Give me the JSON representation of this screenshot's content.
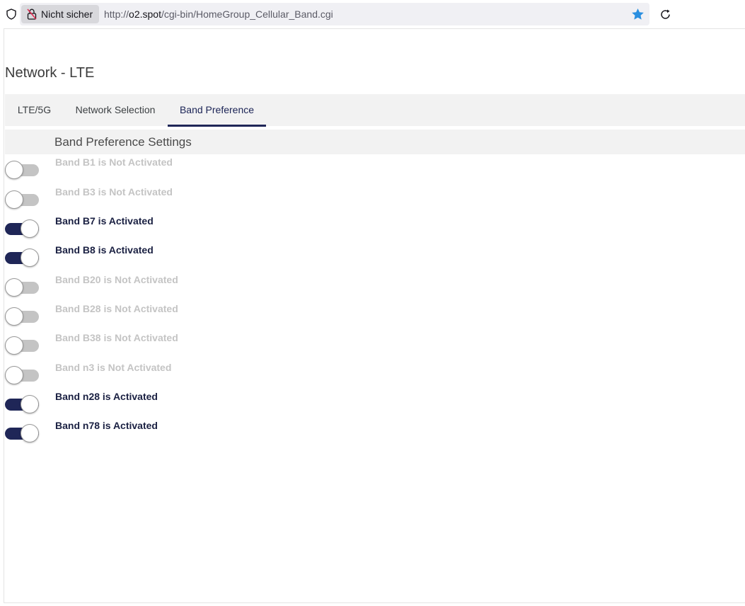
{
  "browser": {
    "security_label": "Nicht sicher",
    "url_prefix": "http://",
    "url_host": "o2.spot",
    "url_path": "/cgi-bin/HomeGroup_Cellular_Band.cgi",
    "bookmark_color": "#2a8fe0"
  },
  "page": {
    "title": "Network - LTE",
    "tabs": [
      {
        "label": "LTE/5G",
        "active": false
      },
      {
        "label": "Network Selection",
        "active": false
      },
      {
        "label": "Band Preference",
        "active": true
      }
    ],
    "section_title": "Band Preference Settings"
  },
  "colors": {
    "accent": "#1f2657",
    "inactive_text": "#c4c4c4",
    "active_text": "#1a2042"
  },
  "bands": [
    {
      "label": "Band B1 is Not Activated",
      "active": false
    },
    {
      "label": "Band B3 is Not Activated",
      "active": false
    },
    {
      "label": "Band B7 is Activated",
      "active": true
    },
    {
      "label": "Band B8 is Activated",
      "active": true
    },
    {
      "label": "Band B20 is Not Activated",
      "active": false
    },
    {
      "label": "Band B28 is Not Activated",
      "active": false
    },
    {
      "label": "Band B38 is Not Activated",
      "active": false
    },
    {
      "label": "Band n3 is Not Activated",
      "active": false
    },
    {
      "label": "Band n28 is Activated",
      "active": true
    },
    {
      "label": "Band n78 is Activated",
      "active": true
    }
  ]
}
